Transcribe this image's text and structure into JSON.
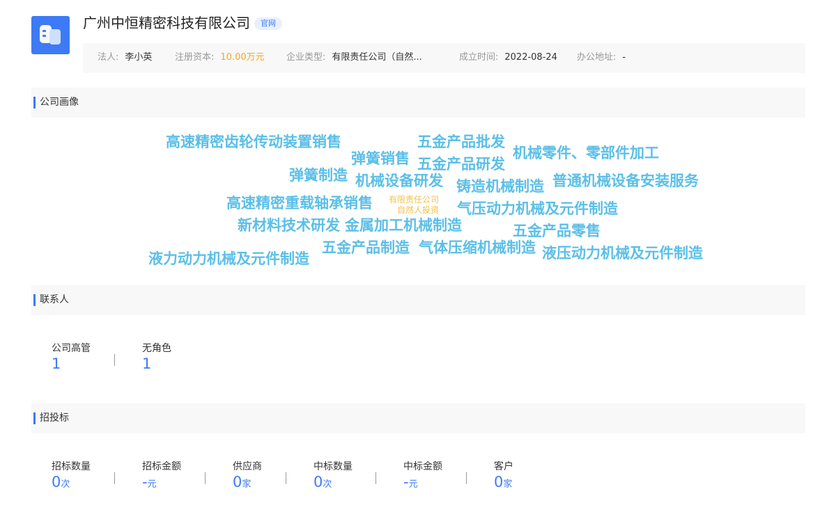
{
  "header": {
    "company_name": "广州中恒精密科技有限公司",
    "site_tag": "官网",
    "accent": "#3d7af5"
  },
  "info": {
    "legal_person": {
      "label": "法人:",
      "value": "李小英"
    },
    "capital": {
      "label": "注册资本:",
      "value": "10.00万元"
    },
    "type": {
      "label": "企业类型:",
      "value": "有限责任公司（自然..."
    },
    "established": {
      "label": "成立时间:",
      "value": "2022-08-24"
    },
    "address": {
      "label": "办公地址:",
      "value": "-"
    }
  },
  "sections": {
    "portrait": "公司画像",
    "contacts": "联系人",
    "bidding": "招投标"
  },
  "word_cloud": [
    "高速精密齿轮传动装置销售",
    "弹簧销售",
    "五金产品批发",
    "机械零件、零部件加工",
    "五金产品研发",
    "弹簧制造",
    "机械设备研发",
    "铸造机械制造",
    "普通机械设备安装服务",
    "高速精密重载轴承销售",
    "有限责任公司",
    "自然人投资",
    "气压动力机械及元件制造",
    "新材料技术研发",
    "金属加工机械制造",
    "五金产品零售",
    "五金产品制造",
    "气体压缩机械制造",
    "液压动力机械及元件制造",
    "液力动力机械及元件制造"
  ],
  "contacts": [
    {
      "label": "公司高管",
      "value": "1"
    },
    {
      "label": "无角色",
      "value": "1"
    }
  ],
  "bidding": [
    {
      "label": "招标数量",
      "value": "0",
      "unit": "次"
    },
    {
      "label": "招标金额",
      "value": "-",
      "unit": "元"
    },
    {
      "label": "供应商",
      "value": "0",
      "unit": "家"
    },
    {
      "label": "中标数量",
      "value": "0",
      "unit": "次"
    },
    {
      "label": "中标金额",
      "value": "-",
      "unit": "元"
    },
    {
      "label": "客户",
      "value": "0",
      "unit": "家"
    }
  ]
}
